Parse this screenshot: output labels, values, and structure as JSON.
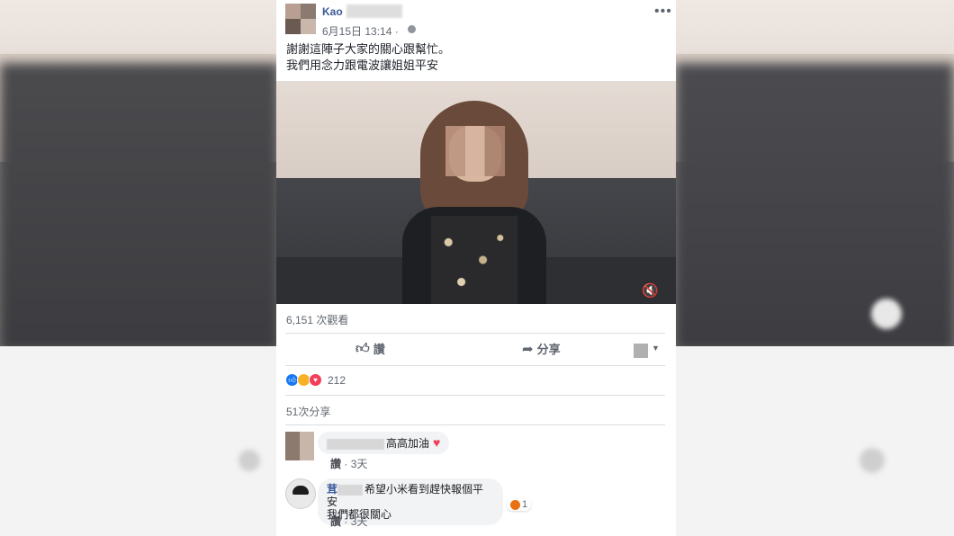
{
  "post": {
    "author": "Kao",
    "time": "6月15日 13:14 ·",
    "text": "謝謝這陣子大家的關心跟幫忙。\n我們用念力跟電波讓姐姐平安",
    "more": "•••"
  },
  "video": {
    "views": "6,151 次觀看"
  },
  "actions": {
    "like": "讚",
    "share": "分享"
  },
  "stats": {
    "reactions": "212",
    "shares": "51次分享"
  },
  "comments": [
    {
      "name": "",
      "text": "高高加油",
      "like": "讚",
      "time": "3天"
    },
    {
      "name": "茸",
      "text": "希望小米看到趕快報個平安",
      "text2": "我們都很關心",
      "reaction_count": "1",
      "like": "讚",
      "time": "3天"
    }
  ],
  "colors": {
    "link": "#385898",
    "reaction_like": "#1877f2",
    "reaction_love": "#f33e58",
    "reaction_wow": "#f7b125"
  }
}
